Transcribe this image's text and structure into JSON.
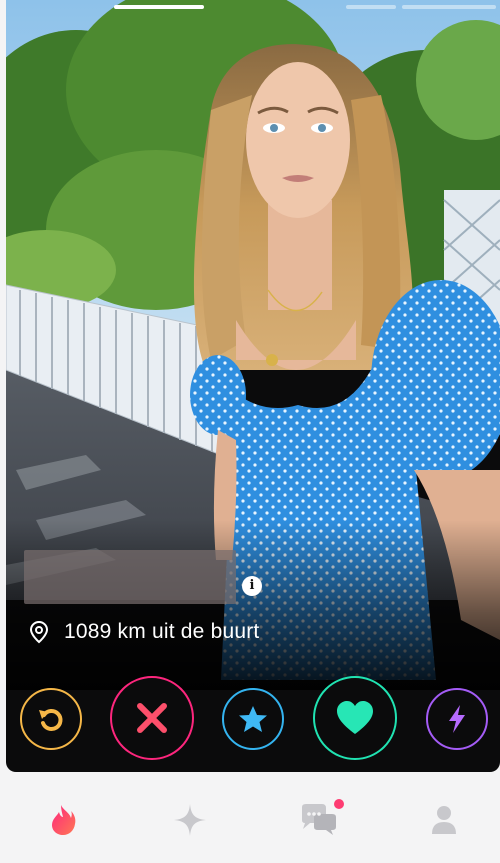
{
  "profile": {
    "distance_text": "1089 km uit de buurt",
    "info_icon": "i",
    "photo_count": 3,
    "active_photo": 1
  },
  "actions": [
    {
      "name": "rewind",
      "icon": "rewind-icon",
      "color": "#f5b748"
    },
    {
      "name": "nope",
      "icon": "close-icon",
      "color": "#fd267d"
    },
    {
      "name": "super-like",
      "icon": "star-icon",
      "color": "#34b4f0"
    },
    {
      "name": "like",
      "icon": "heart-icon",
      "color": "#20e3b2"
    },
    {
      "name": "boost",
      "icon": "lightning-icon",
      "color": "#a45cf6"
    }
  ],
  "nav": [
    {
      "name": "discover",
      "icon": "flame-icon",
      "active": true,
      "color": "#fe3c72"
    },
    {
      "name": "top-picks",
      "icon": "sparkle-icon",
      "active": false
    },
    {
      "name": "messages",
      "icon": "chat-icon",
      "active": false,
      "badge": true
    },
    {
      "name": "profile",
      "icon": "person-icon",
      "active": false
    }
  ],
  "colors": {
    "brand": "#fe3c72",
    "inactive_nav": "#c8c8cc"
  }
}
